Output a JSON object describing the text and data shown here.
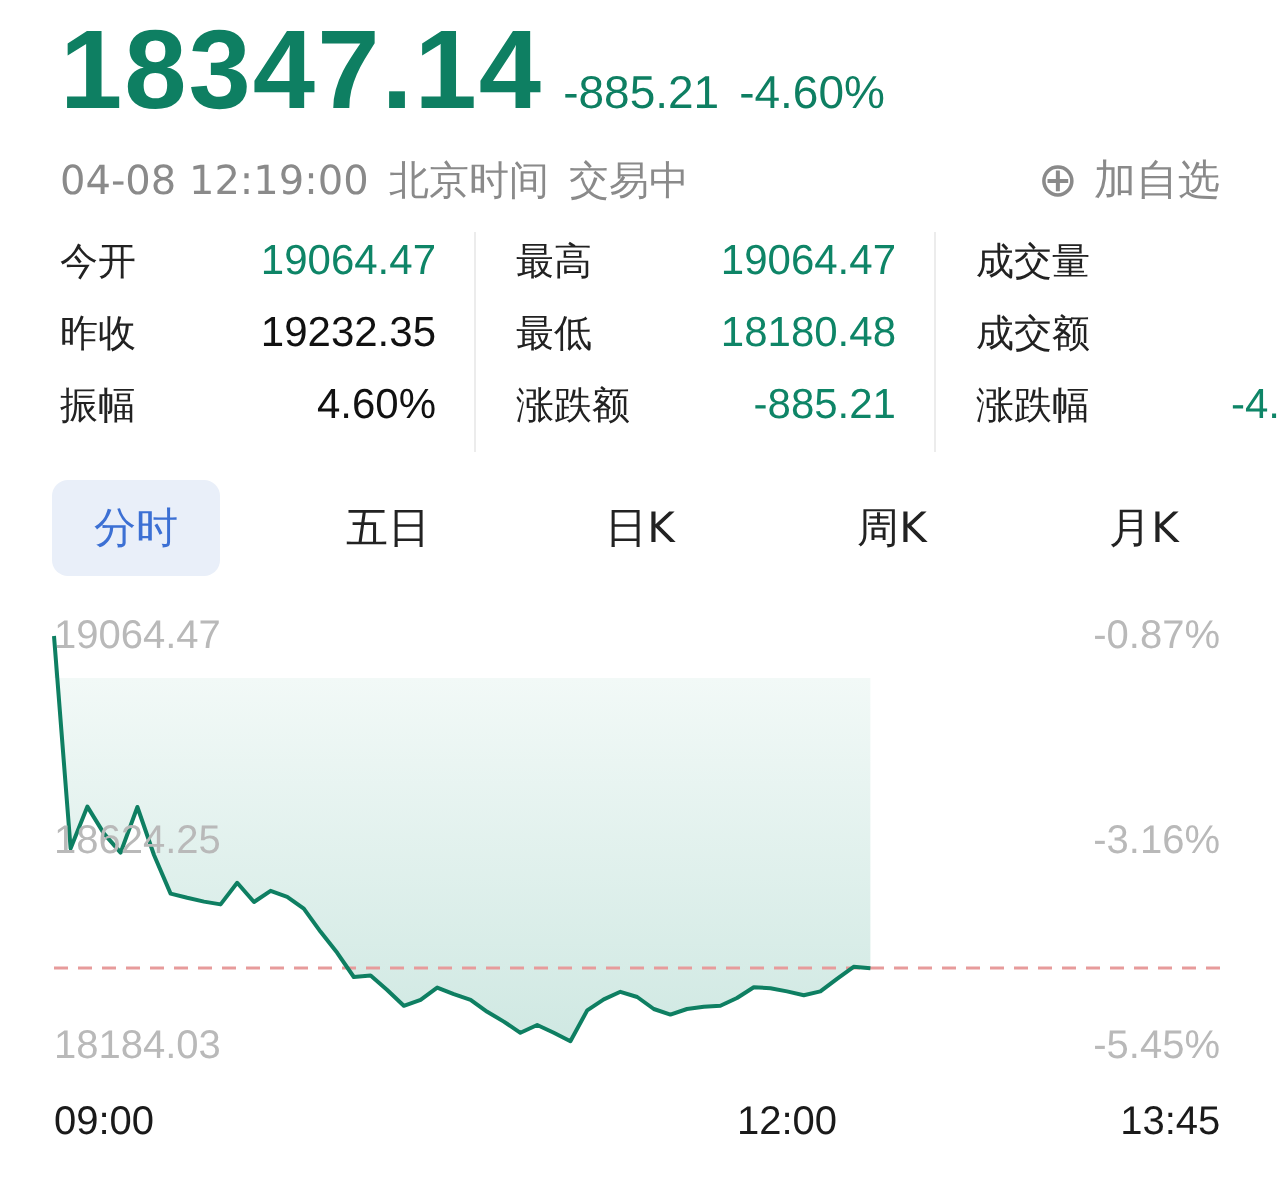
{
  "quote": {
    "price": "18347.14",
    "change": "-885.21",
    "change_percent": "-4.60%",
    "timestamp": "04-08 12:19:00",
    "timezone": "北京时间",
    "status": "交易中",
    "watchlist_icon": "⊕",
    "watchlist_label": "加自选"
  },
  "stats": [
    {
      "items": [
        {
          "label": "今开",
          "value": "19064.47",
          "color": "#0e8567"
        },
        {
          "label": "昨收",
          "value": "19232.35",
          "color": "#111111"
        },
        {
          "label": "振幅",
          "value": "4.60%",
          "color": "#111111"
        }
      ]
    },
    {
      "items": [
        {
          "label": "最高",
          "value": "19064.47",
          "color": "#0e8567"
        },
        {
          "label": "最低",
          "value": "18180.48",
          "color": "#0e8567"
        },
        {
          "label": "涨跌额",
          "value": "-885.21",
          "color": "#0e8567"
        }
      ]
    },
    {
      "items": [
        {
          "label": "成交量"
        },
        {
          "label": "成交额"
        },
        {
          "label": "涨跌幅",
          "value": "-4.",
          "color": "#0e8567"
        }
      ]
    }
  ],
  "tabs": [
    {
      "label": "分时",
      "selected": true
    },
    {
      "label": "五日",
      "selected": false
    },
    {
      "label": "日K",
      "selected": false
    },
    {
      "label": "周K",
      "selected": false
    },
    {
      "label": "月K",
      "selected": false
    }
  ],
  "chart": {
    "chart_data": {
      "type": "line",
      "ylim": [
        18184.03,
        19064.47
      ],
      "categories": [
        null,
        null,
        null,
        "09:00",
        null,
        null,
        null,
        null,
        null,
        null,
        null,
        null,
        null,
        null,
        null,
        null,
        null,
        null,
        null,
        null,
        null,
        null,
        null,
        null,
        null,
        null,
        null,
        null,
        null,
        null,
        null,
        null,
        null,
        null,
        null,
        null,
        null,
        null,
        null,
        null,
        null,
        null,
        null,
        null,
        "12:00",
        null,
        null,
        null,
        null,
        null,
        null,
        null,
        null,
        null,
        null,
        null,
        null,
        null,
        null,
        null,
        null,
        null,
        null,
        null,
        null,
        null,
        null,
        "13:45"
      ],
      "yticks": [
        {
          "value": 19064.47,
          "label": "19064.47"
        },
        {
          "value": 18624.25,
          "label": "18624.25"
        },
        {
          "value": 18184.03,
          "label": "18184.03"
        }
      ],
      "annotations": [
        "-0.87%",
        "-3.16%",
        "-5.45%"
      ],
      "series": [
        {
          "color": "#0e7f62",
          "values": [
            19060,
            18604,
            18694,
            18636,
            18595,
            18693,
            18590,
            18507,
            18498,
            18490,
            18484,
            18530,
            18489,
            18513,
            18500,
            18475,
            18425,
            18380,
            18328,
            18331,
            18300,
            18266,
            18279,
            18305,
            18291,
            18279,
            18253,
            18232,
            18208,
            18225,
            18208,
            18190,
            18256,
            18280,
            18296,
            18285,
            18259,
            18247,
            18259,
            18264,
            18266,
            18283,
            18306,
            18304,
            18297,
            18289,
            18297,
            18324,
            18350,
            18347,
            null,
            null,
            null,
            null,
            null,
            null,
            null,
            null,
            null,
            null,
            null,
            null,
            null,
            null,
            null,
            null,
            null,
            null
          ]
        }
      ]
    }
  }
}
